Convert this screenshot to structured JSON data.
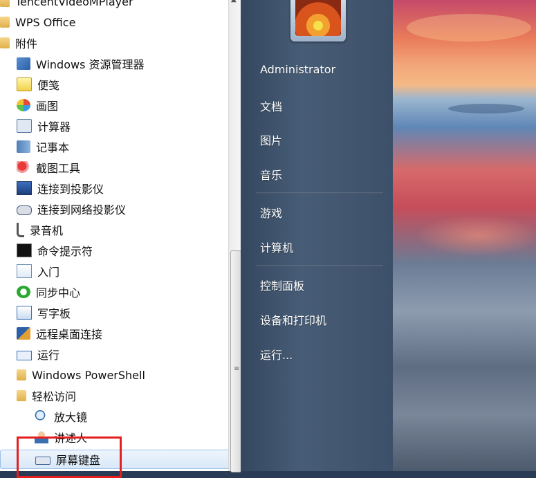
{
  "programs": [
    {
      "label": "TencentVideoMPlayer",
      "icon": "folder-icon",
      "level": 0
    },
    {
      "label": "WPS Office",
      "icon": "folder-icon",
      "level": 0
    },
    {
      "label": "附件",
      "icon": "folder-icon",
      "level": 0
    },
    {
      "label": "Windows 资源管理器",
      "icon": "explorer-icon",
      "level": 1
    },
    {
      "label": "便笺",
      "icon": "sticky-note-icon",
      "level": 1
    },
    {
      "label": "画图",
      "icon": "paint-icon",
      "level": 1
    },
    {
      "label": "计算器",
      "icon": "calculator-icon",
      "level": 1
    },
    {
      "label": "记事本",
      "icon": "notepad-icon",
      "level": 1
    },
    {
      "label": "截图工具",
      "icon": "snipping-tool-icon",
      "level": 1
    },
    {
      "label": "连接到投影仪",
      "icon": "projector-icon",
      "level": 1
    },
    {
      "label": "连接到网络投影仪",
      "icon": "network-projector-icon",
      "level": 1
    },
    {
      "label": "录音机",
      "icon": "microphone-icon",
      "level": 1
    },
    {
      "label": "命令提示符",
      "icon": "cmd-icon",
      "level": 1
    },
    {
      "label": "入门",
      "icon": "getting-started-icon",
      "level": 1
    },
    {
      "label": "同步中心",
      "icon": "sync-center-icon",
      "level": 1
    },
    {
      "label": "写字板",
      "icon": "wordpad-icon",
      "level": 1
    },
    {
      "label": "远程桌面连接",
      "icon": "remote-desktop-icon",
      "level": 1
    },
    {
      "label": "运行",
      "icon": "run-icon",
      "level": 1
    },
    {
      "label": "Windows PowerShell",
      "icon": "folder-icon",
      "level": 1
    },
    {
      "label": "轻松访问",
      "icon": "folder-icon",
      "level": 1
    },
    {
      "label": "放大镜",
      "icon": "magnifier-icon",
      "level": 2
    },
    {
      "label": "讲述人",
      "icon": "narrator-icon",
      "level": 2
    },
    {
      "label": "屏幕键盘",
      "icon": "keyboard-icon",
      "level": 2,
      "selected": true
    }
  ],
  "right_menu": {
    "items": [
      "Administrator",
      "文档",
      "图片",
      "音乐",
      "游戏",
      "计算机",
      "控制面板",
      "设备和打印机",
      "运行..."
    ]
  },
  "scrollbar": {
    "grip": "≡"
  }
}
